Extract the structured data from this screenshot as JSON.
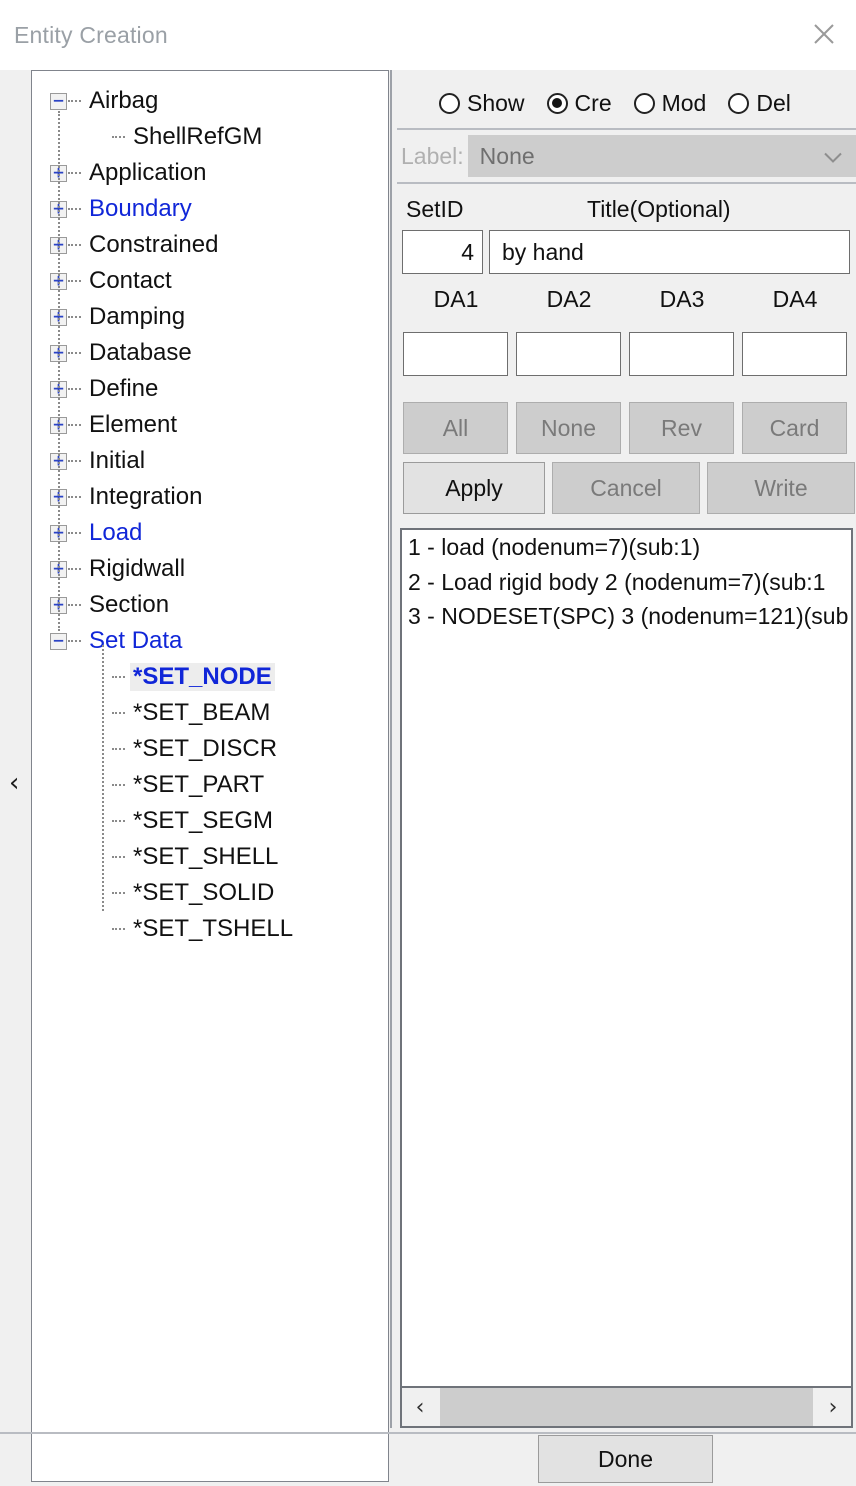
{
  "window": {
    "title": "Entity Creation",
    "close_icon": "close-icon"
  },
  "collapse": {
    "icon": "chevron-left-icon",
    "glyph": "‹"
  },
  "tree": {
    "nodes": [
      {
        "label": "Airbag",
        "expander": "−",
        "depth": 0,
        "style": "plain"
      },
      {
        "label": "ShellRefGM",
        "expander": "",
        "depth": 1,
        "style": "plain"
      },
      {
        "label": "Application",
        "expander": "+",
        "depth": 0,
        "style": "plain"
      },
      {
        "label": "Boundary",
        "expander": "+",
        "depth": 0,
        "style": "blue"
      },
      {
        "label": "Constrained",
        "expander": "+",
        "depth": 0,
        "style": "plain"
      },
      {
        "label": "Contact",
        "expander": "+",
        "depth": 0,
        "style": "plain"
      },
      {
        "label": "Damping",
        "expander": "+",
        "depth": 0,
        "style": "plain"
      },
      {
        "label": "Database",
        "expander": "+",
        "depth": 0,
        "style": "plain"
      },
      {
        "label": "Define",
        "expander": "+",
        "depth": 0,
        "style": "plain"
      },
      {
        "label": "Element",
        "expander": "+",
        "depth": 0,
        "style": "plain"
      },
      {
        "label": "Initial",
        "expander": "+",
        "depth": 0,
        "style": "plain"
      },
      {
        "label": "Integration",
        "expander": "+",
        "depth": 0,
        "style": "plain"
      },
      {
        "label": "Load",
        "expander": "+",
        "depth": 0,
        "style": "blue"
      },
      {
        "label": "Rigidwall",
        "expander": "+",
        "depth": 0,
        "style": "plain"
      },
      {
        "label": "Section",
        "expander": "+",
        "depth": 0,
        "style": "plain"
      },
      {
        "label": "Set Data",
        "expander": "−",
        "depth": 0,
        "style": "blue"
      },
      {
        "label": "*SET_NODE",
        "expander": "",
        "depth": 1,
        "style": "selected"
      },
      {
        "label": "*SET_BEAM",
        "expander": "",
        "depth": 1,
        "style": "plain"
      },
      {
        "label": "*SET_DISCR",
        "expander": "",
        "depth": 1,
        "style": "plain"
      },
      {
        "label": "*SET_PART",
        "expander": "",
        "depth": 1,
        "style": "plain"
      },
      {
        "label": "*SET_SEGM",
        "expander": "",
        "depth": 1,
        "style": "plain"
      },
      {
        "label": "*SET_SHELL",
        "expander": "",
        "depth": 1,
        "style": "plain"
      },
      {
        "label": "*SET_SOLID",
        "expander": "",
        "depth": 1,
        "style": "plain"
      },
      {
        "label": "*SET_TSHELL",
        "expander": "",
        "depth": 1,
        "style": "plain"
      }
    ]
  },
  "modes": {
    "options": [
      {
        "label": "Show",
        "checked": false
      },
      {
        "label": "Cre",
        "checked": true
      },
      {
        "label": "Mod",
        "checked": false
      },
      {
        "label": "Del",
        "checked": false
      }
    ]
  },
  "label_row": {
    "caption": "Label:",
    "value": "None",
    "disabled": true,
    "arrow_icon": "chevron-down-icon"
  },
  "form": {
    "setid_header": "SetID",
    "title_header": "Title(Optional)",
    "setid_value": "4",
    "title_value": "by hand",
    "da_headers": [
      "DA1",
      "DA2",
      "DA3",
      "DA4"
    ],
    "da_values": [
      "",
      "",
      "",
      ""
    ]
  },
  "select_buttons": [
    {
      "label": "All",
      "enabled": false
    },
    {
      "label": "None",
      "enabled": false
    },
    {
      "label": "Rev",
      "enabled": false
    },
    {
      "label": "Card",
      "enabled": false
    }
  ],
  "action_buttons": [
    {
      "label": "Apply",
      "enabled": true
    },
    {
      "label": "Cancel",
      "enabled": false
    },
    {
      "label": "Write",
      "enabled": false
    }
  ],
  "list": {
    "items": [
      "1 - load (nodenum=7)(sub:1)",
      "2 - Load rigid body 2 (nodenum=7)(sub:1",
      "3 - NODESET(SPC) 3 (nodenum=121)(sub"
    ]
  },
  "scrollbar": {
    "left_icon": "chevron-left-icon",
    "right_icon": "chevron-right-icon",
    "left_glyph": "‹",
    "right_glyph": "›"
  },
  "footer": {
    "done_label": "Done"
  },
  "colors": {
    "accent_blue": "#1026d8",
    "panel_bg": "#f0f0f0",
    "disabled_text": "#7a7a7a",
    "border": "#6f737a"
  }
}
